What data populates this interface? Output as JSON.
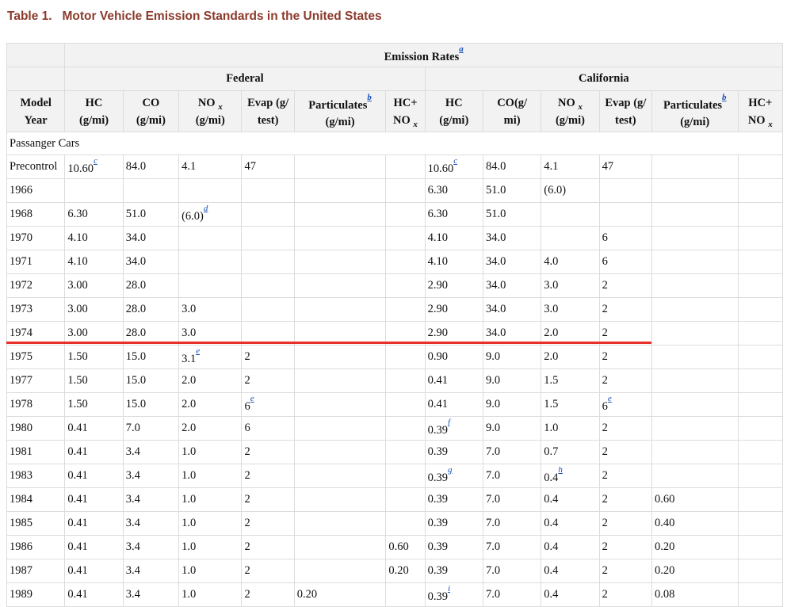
{
  "title": {
    "label": "Table 1.",
    "text": "Motor Vehicle Emission Standards in the United States"
  },
  "header": {
    "emission_rates": "Emission Rates",
    "emission_rates_fn": "a",
    "federal": "Federal",
    "california": "California",
    "model_year": [
      "Model",
      "Year"
    ],
    "hc": [
      "HC",
      "(g/mi)"
    ],
    "co": [
      "CO",
      "(g/mi)"
    ],
    "co_ca": [
      "CO(g/",
      "mi)"
    ],
    "nox": [
      "NO",
      "x",
      "(g/mi)"
    ],
    "evap": [
      "Evap (g/",
      "test)"
    ],
    "particulates": [
      "Particulates",
      "(g/mi)"
    ],
    "particulates_fn": "b",
    "hcnox": [
      "HC+",
      "NO",
      "x"
    ]
  },
  "section": "Passanger Cars",
  "rows": [
    {
      "year": "Precontrol",
      "f_hc": "10.60",
      "f_hc_fn": "c",
      "f_co": "84.0",
      "f_nox": "4.1",
      "f_nox_fn": "",
      "f_evap": "47",
      "f_evap_fn": "",
      "f_part": "",
      "f_hcnox": "",
      "c_hc": "10.60",
      "c_hc_fn": "c",
      "c_co": "84.0",
      "c_nox": "4.1",
      "c_nox_fn": "",
      "c_evap": "47",
      "c_evap_fn": "",
      "c_part": "",
      "c_hcnox": ""
    },
    {
      "year": "1966",
      "f_hc": "",
      "f_hc_fn": "",
      "f_co": "",
      "f_nox": "",
      "f_nox_fn": "",
      "f_evap": "",
      "f_evap_fn": "",
      "f_part": "",
      "f_hcnox": "",
      "c_hc": "6.30",
      "c_hc_fn": "",
      "c_co": "51.0",
      "c_nox": "(6.0)",
      "c_nox_fn": "",
      "c_evap": "",
      "c_evap_fn": "",
      "c_part": "",
      "c_hcnox": ""
    },
    {
      "year": "1968",
      "f_hc": "6.30",
      "f_hc_fn": "",
      "f_co": "51.0",
      "f_nox": "(6.0)",
      "f_nox_fn": "d",
      "f_evap": "",
      "f_evap_fn": "",
      "f_part": "",
      "f_hcnox": "",
      "c_hc": "6.30",
      "c_hc_fn": "",
      "c_co": "51.0",
      "c_nox": "",
      "c_nox_fn": "",
      "c_evap": "",
      "c_evap_fn": "",
      "c_part": "",
      "c_hcnox": ""
    },
    {
      "year": "1970",
      "f_hc": "4.10",
      "f_hc_fn": "",
      "f_co": "34.0",
      "f_nox": "",
      "f_nox_fn": "",
      "f_evap": "",
      "f_evap_fn": "",
      "f_part": "",
      "f_hcnox": "",
      "c_hc": "4.10",
      "c_hc_fn": "",
      "c_co": "34.0",
      "c_nox": "",
      "c_nox_fn": "",
      "c_evap": "6",
      "c_evap_fn": "",
      "c_part": "",
      "c_hcnox": ""
    },
    {
      "year": "1971",
      "f_hc": "4.10",
      "f_hc_fn": "",
      "f_co": "34.0",
      "f_nox": "",
      "f_nox_fn": "",
      "f_evap": "",
      "f_evap_fn": "",
      "f_part": "",
      "f_hcnox": "",
      "c_hc": "4.10",
      "c_hc_fn": "",
      "c_co": "34.0",
      "c_nox": "4.0",
      "c_nox_fn": "",
      "c_evap": "6",
      "c_evap_fn": "",
      "c_part": "",
      "c_hcnox": ""
    },
    {
      "year": "1972",
      "f_hc": "3.00",
      "f_hc_fn": "",
      "f_co": "28.0",
      "f_nox": "",
      "f_nox_fn": "",
      "f_evap": "",
      "f_evap_fn": "",
      "f_part": "",
      "f_hcnox": "",
      "c_hc": "2.90",
      "c_hc_fn": "",
      "c_co": "34.0",
      "c_nox": "3.0",
      "c_nox_fn": "",
      "c_evap": "2",
      "c_evap_fn": "",
      "c_part": "",
      "c_hcnox": ""
    },
    {
      "year": "1973",
      "f_hc": "3.00",
      "f_hc_fn": "",
      "f_co": "28.0",
      "f_nox": "3.0",
      "f_nox_fn": "",
      "f_evap": "",
      "f_evap_fn": "",
      "f_part": "",
      "f_hcnox": "",
      "c_hc": "2.90",
      "c_hc_fn": "",
      "c_co": "34.0",
      "c_nox": "3.0",
      "c_nox_fn": "",
      "c_evap": "2",
      "c_evap_fn": "",
      "c_part": "",
      "c_hcnox": ""
    },
    {
      "year": "1974",
      "f_hc": "3.00",
      "f_hc_fn": "",
      "f_co": "28.0",
      "f_nox": "3.0",
      "f_nox_fn": "",
      "f_evap": "",
      "f_evap_fn": "",
      "f_part": "",
      "f_hcnox": "",
      "c_hc": "2.90",
      "c_hc_fn": "",
      "c_co": "34.0",
      "c_nox": "2.0",
      "c_nox_fn": "",
      "c_evap": "2",
      "c_evap_fn": "",
      "c_part": "",
      "c_hcnox": ""
    },
    {
      "year": "1975",
      "f_hc": "1.50",
      "f_hc_fn": "",
      "f_co": "15.0",
      "f_nox": "3.1",
      "f_nox_fn": "e",
      "f_evap": "2",
      "f_evap_fn": "",
      "f_part": "",
      "f_hcnox": "",
      "c_hc": "0.90",
      "c_hc_fn": "",
      "c_co": "9.0",
      "c_nox": "2.0",
      "c_nox_fn": "",
      "c_evap": "2",
      "c_evap_fn": "",
      "c_part": "",
      "c_hcnox": ""
    },
    {
      "year": "1977",
      "f_hc": "1.50",
      "f_hc_fn": "",
      "f_co": "15.0",
      "f_nox": "2.0",
      "f_nox_fn": "",
      "f_evap": "2",
      "f_evap_fn": "",
      "f_part": "",
      "f_hcnox": "",
      "c_hc": "0.41",
      "c_hc_fn": "",
      "c_co": "9.0",
      "c_nox": "1.5",
      "c_nox_fn": "",
      "c_evap": "2",
      "c_evap_fn": "",
      "c_part": "",
      "c_hcnox": ""
    },
    {
      "year": "1978",
      "f_hc": "1.50",
      "f_hc_fn": "",
      "f_co": "15.0",
      "f_nox": "2.0",
      "f_nox_fn": "",
      "f_evap": "6",
      "f_evap_fn": "e",
      "f_part": "",
      "f_hcnox": "",
      "c_hc": "0.41",
      "c_hc_fn": "",
      "c_co": "9.0",
      "c_nox": "1.5",
      "c_nox_fn": "",
      "c_evap": "6",
      "c_evap_fn": "e",
      "c_part": "",
      "c_hcnox": ""
    },
    {
      "year": "1980",
      "f_hc": "0.41",
      "f_hc_fn": "",
      "f_co": "7.0",
      "f_nox": "2.0",
      "f_nox_fn": "",
      "f_evap": "6",
      "f_evap_fn": "",
      "f_part": "",
      "f_hcnox": "",
      "c_hc": "0.39",
      "c_hc_fn": "f",
      "c_co": "9.0",
      "c_nox": "1.0",
      "c_nox_fn": "",
      "c_evap": "2",
      "c_evap_fn": "",
      "c_part": "",
      "c_hcnox": ""
    },
    {
      "year": "1981",
      "f_hc": "0.41",
      "f_hc_fn": "",
      "f_co": "3.4",
      "f_nox": "1.0",
      "f_nox_fn": "",
      "f_evap": "2",
      "f_evap_fn": "",
      "f_part": "",
      "f_hcnox": "",
      "c_hc": "0.39",
      "c_hc_fn": "",
      "c_co": "7.0",
      "c_nox": "0.7",
      "c_nox_fn": "",
      "c_evap": "2",
      "c_evap_fn": "",
      "c_part": "",
      "c_hcnox": ""
    },
    {
      "year": "1983",
      "f_hc": "0.41",
      "f_hc_fn": "",
      "f_co": "3.4",
      "f_nox": "1.0",
      "f_nox_fn": "",
      "f_evap": "2",
      "f_evap_fn": "",
      "f_part": "",
      "f_hcnox": "",
      "c_hc": "0.39",
      "c_hc_fn": "g",
      "c_co": "7.0",
      "c_nox": "0.4",
      "c_nox_fn": "h",
      "c_evap": "2",
      "c_evap_fn": "",
      "c_part": "",
      "c_hcnox": ""
    },
    {
      "year": "1984",
      "f_hc": "0.41",
      "f_hc_fn": "",
      "f_co": "3.4",
      "f_nox": "1.0",
      "f_nox_fn": "",
      "f_evap": "2",
      "f_evap_fn": "",
      "f_part": "",
      "f_hcnox": "",
      "c_hc": "0.39",
      "c_hc_fn": "",
      "c_co": "7.0",
      "c_nox": "0.4",
      "c_nox_fn": "",
      "c_evap": "2",
      "c_evap_fn": "",
      "c_part": "0.60",
      "c_hcnox": ""
    },
    {
      "year": "1985",
      "f_hc": "0.41",
      "f_hc_fn": "",
      "f_co": "3.4",
      "f_nox": "1.0",
      "f_nox_fn": "",
      "f_evap": "2",
      "f_evap_fn": "",
      "f_part": "",
      "f_hcnox": "",
      "c_hc": "0.39",
      "c_hc_fn": "",
      "c_co": "7.0",
      "c_nox": "0.4",
      "c_nox_fn": "",
      "c_evap": "2",
      "c_evap_fn": "",
      "c_part": "0.40",
      "c_hcnox": ""
    },
    {
      "year": "1986",
      "f_hc": "0.41",
      "f_hc_fn": "",
      "f_co": "3.4",
      "f_nox": "1.0",
      "f_nox_fn": "",
      "f_evap": "2",
      "f_evap_fn": "",
      "f_part": "",
      "f_hcnox": "0.60",
      "c_hc": "0.39",
      "c_hc_fn": "",
      "c_co": "7.0",
      "c_nox": "0.4",
      "c_nox_fn": "",
      "c_evap": "2",
      "c_evap_fn": "",
      "c_part": "0.20",
      "c_hcnox": ""
    },
    {
      "year": "1987",
      "f_hc": "0.41",
      "f_hc_fn": "",
      "f_co": "3.4",
      "f_nox": "1.0",
      "f_nox_fn": "",
      "f_evap": "2",
      "f_evap_fn": "",
      "f_part": "",
      "f_hcnox": "0.20",
      "c_hc": "0.39",
      "c_hc_fn": "",
      "c_co": "7.0",
      "c_nox": "0.4",
      "c_nox_fn": "",
      "c_evap": "2",
      "c_evap_fn": "",
      "c_part": "0.20",
      "c_hcnox": ""
    },
    {
      "year": "1989",
      "f_hc": "0.41",
      "f_hc_fn": "",
      "f_co": "3.4",
      "f_nox": "1.0",
      "f_nox_fn": "",
      "f_evap": "2",
      "f_evap_fn": "",
      "f_part": "0.20",
      "f_hcnox": "",
      "c_hc": "0.39",
      "c_hc_fn": "i",
      "c_co": "7.0",
      "c_nox": "0.4",
      "c_nox_fn": "",
      "c_evap": "2",
      "c_evap_fn": "",
      "c_part": "0.08",
      "c_hcnox": ""
    }
  ],
  "colors": {
    "title": "#8b3a2b",
    "link": "#1a4fb5",
    "highlight_line": "#e8302a",
    "header_bg": "#f2f2f2",
    "grid": "#dcdcdc"
  }
}
